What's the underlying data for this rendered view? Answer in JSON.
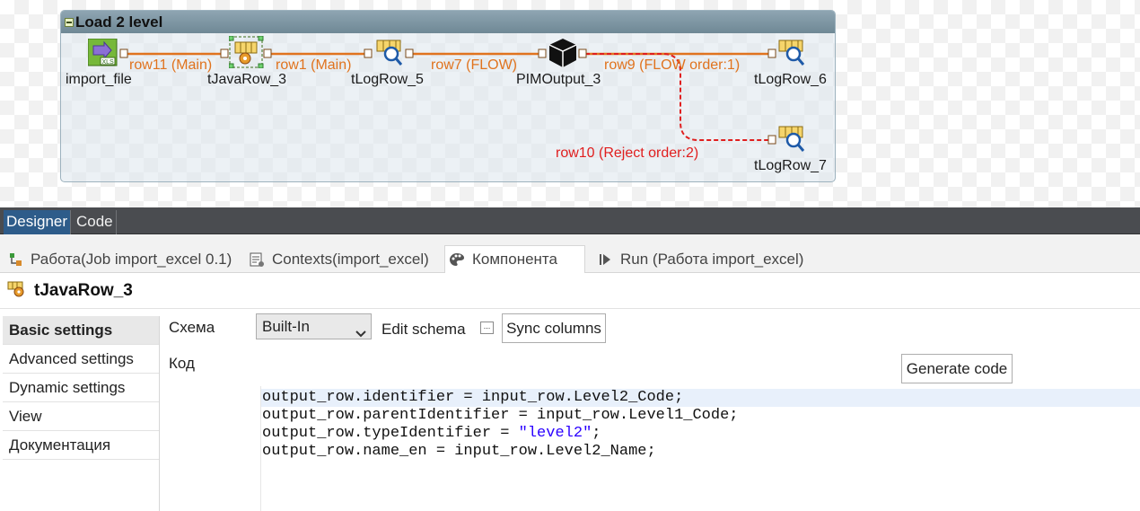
{
  "subjob": {
    "title": "Load 2 level"
  },
  "components": [
    {
      "name": "import_file"
    },
    {
      "name": "tJavaRow_3"
    },
    {
      "name": "tLogRow_5"
    },
    {
      "name": "PIMOutput_3"
    },
    {
      "name": "tLogRow_6"
    },
    {
      "name": "tLogRow_7"
    }
  ],
  "links": [
    {
      "label": "row11 (Main)"
    },
    {
      "label": "row1 (Main)"
    },
    {
      "label": "row7 (FLOW)"
    },
    {
      "label": "row9 (FLOW order:1)"
    },
    {
      "label": "row10 (Reject order:2)"
    }
  ],
  "colors": {
    "flow": "#e0731e",
    "reject": "#e01e1e",
    "header": "#7f98a6"
  },
  "view_tabs": {
    "designer": "Designer",
    "code": "Code"
  },
  "panel_tabs": [
    {
      "label": "Работа(Job import_excel 0.1)",
      "icon": "job-icon"
    },
    {
      "label": "Contexts(import_excel)",
      "icon": "contexts-icon"
    },
    {
      "label": "Компонента",
      "icon": "palette-icon"
    },
    {
      "label": "Run (Работа import_excel)",
      "icon": "run-icon"
    }
  ],
  "component_header": {
    "title": "tJavaRow_3"
  },
  "settings_menu": [
    "Basic settings",
    "Advanced settings",
    "Dynamic settings",
    "View",
    "Документация"
  ],
  "form": {
    "schema_label": "Схема",
    "schema_value": "Built-In",
    "edit_schema_label": "Edit schema",
    "edit_schema_button": "...",
    "sync_columns": "Sync columns",
    "code_label": "Код",
    "generate_code": "Generate code"
  },
  "code": {
    "line1": "output_row.identifier = input_row.Level2_Code;",
    "line2": "output_row.parentIdentifier = input_row.Level1_Code;",
    "line3_prefix": "output_row.typeIdentifier = ",
    "line3_string": "\"level2\"",
    "line3_suffix": ";",
    "line4": "output_row.name_en = input_row.Level2_Name;"
  }
}
